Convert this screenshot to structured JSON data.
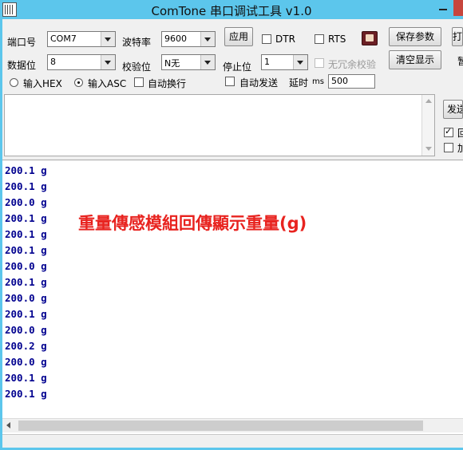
{
  "window": {
    "title": "ComTone 串口调试工具 v1.0"
  },
  "settings": {
    "port_label": "端口号",
    "port_value": "COM7",
    "baud_label": "波特率",
    "baud_value": "9600",
    "apply_label": "应用",
    "dtr_label": "DTR",
    "rts_label": "RTS",
    "save_params_label": "保存参数",
    "right_btn_partial": "打",
    "databits_label": "数据位",
    "databits_value": "8",
    "parity_label": "校验位",
    "parity_value": "N无",
    "stopbits_label": "停止位",
    "stopbits_value": "1",
    "redundancy_label": "无冗余校验",
    "clear_label": "清空显示",
    "right_label_partial": "暂"
  },
  "mode": {
    "hex_label": "输入HEX",
    "asc_label": "输入ASC",
    "asc_selected": true,
    "wrap_label": "自动换行",
    "auto_send_label": "自动发送",
    "delay_label": "延时",
    "delay_unit": "ms",
    "delay_value": "500"
  },
  "send_panel": {
    "send_button_partial": "发送",
    "check1_label_partial": "回",
    "check1_checked": true,
    "check2_label_partial": "加"
  },
  "receive": {
    "lines": [
      "200.1 g",
      "200.1 g",
      "200.0 g",
      "200.1 g",
      "200.1 g",
      "200.1 g",
      "200.0 g",
      "200.1 g",
      "200.0 g",
      "200.1 g",
      "200.0 g",
      "200.2 g",
      "200.0 g",
      "200.1 g",
      "200.1 g"
    ],
    "annotation": "重量傳感模組回傳顯示重量(g)"
  },
  "colors": {
    "titlebar": "#5cc6ec",
    "receive_text": "#00008f",
    "annotation": "#e8231f"
  }
}
